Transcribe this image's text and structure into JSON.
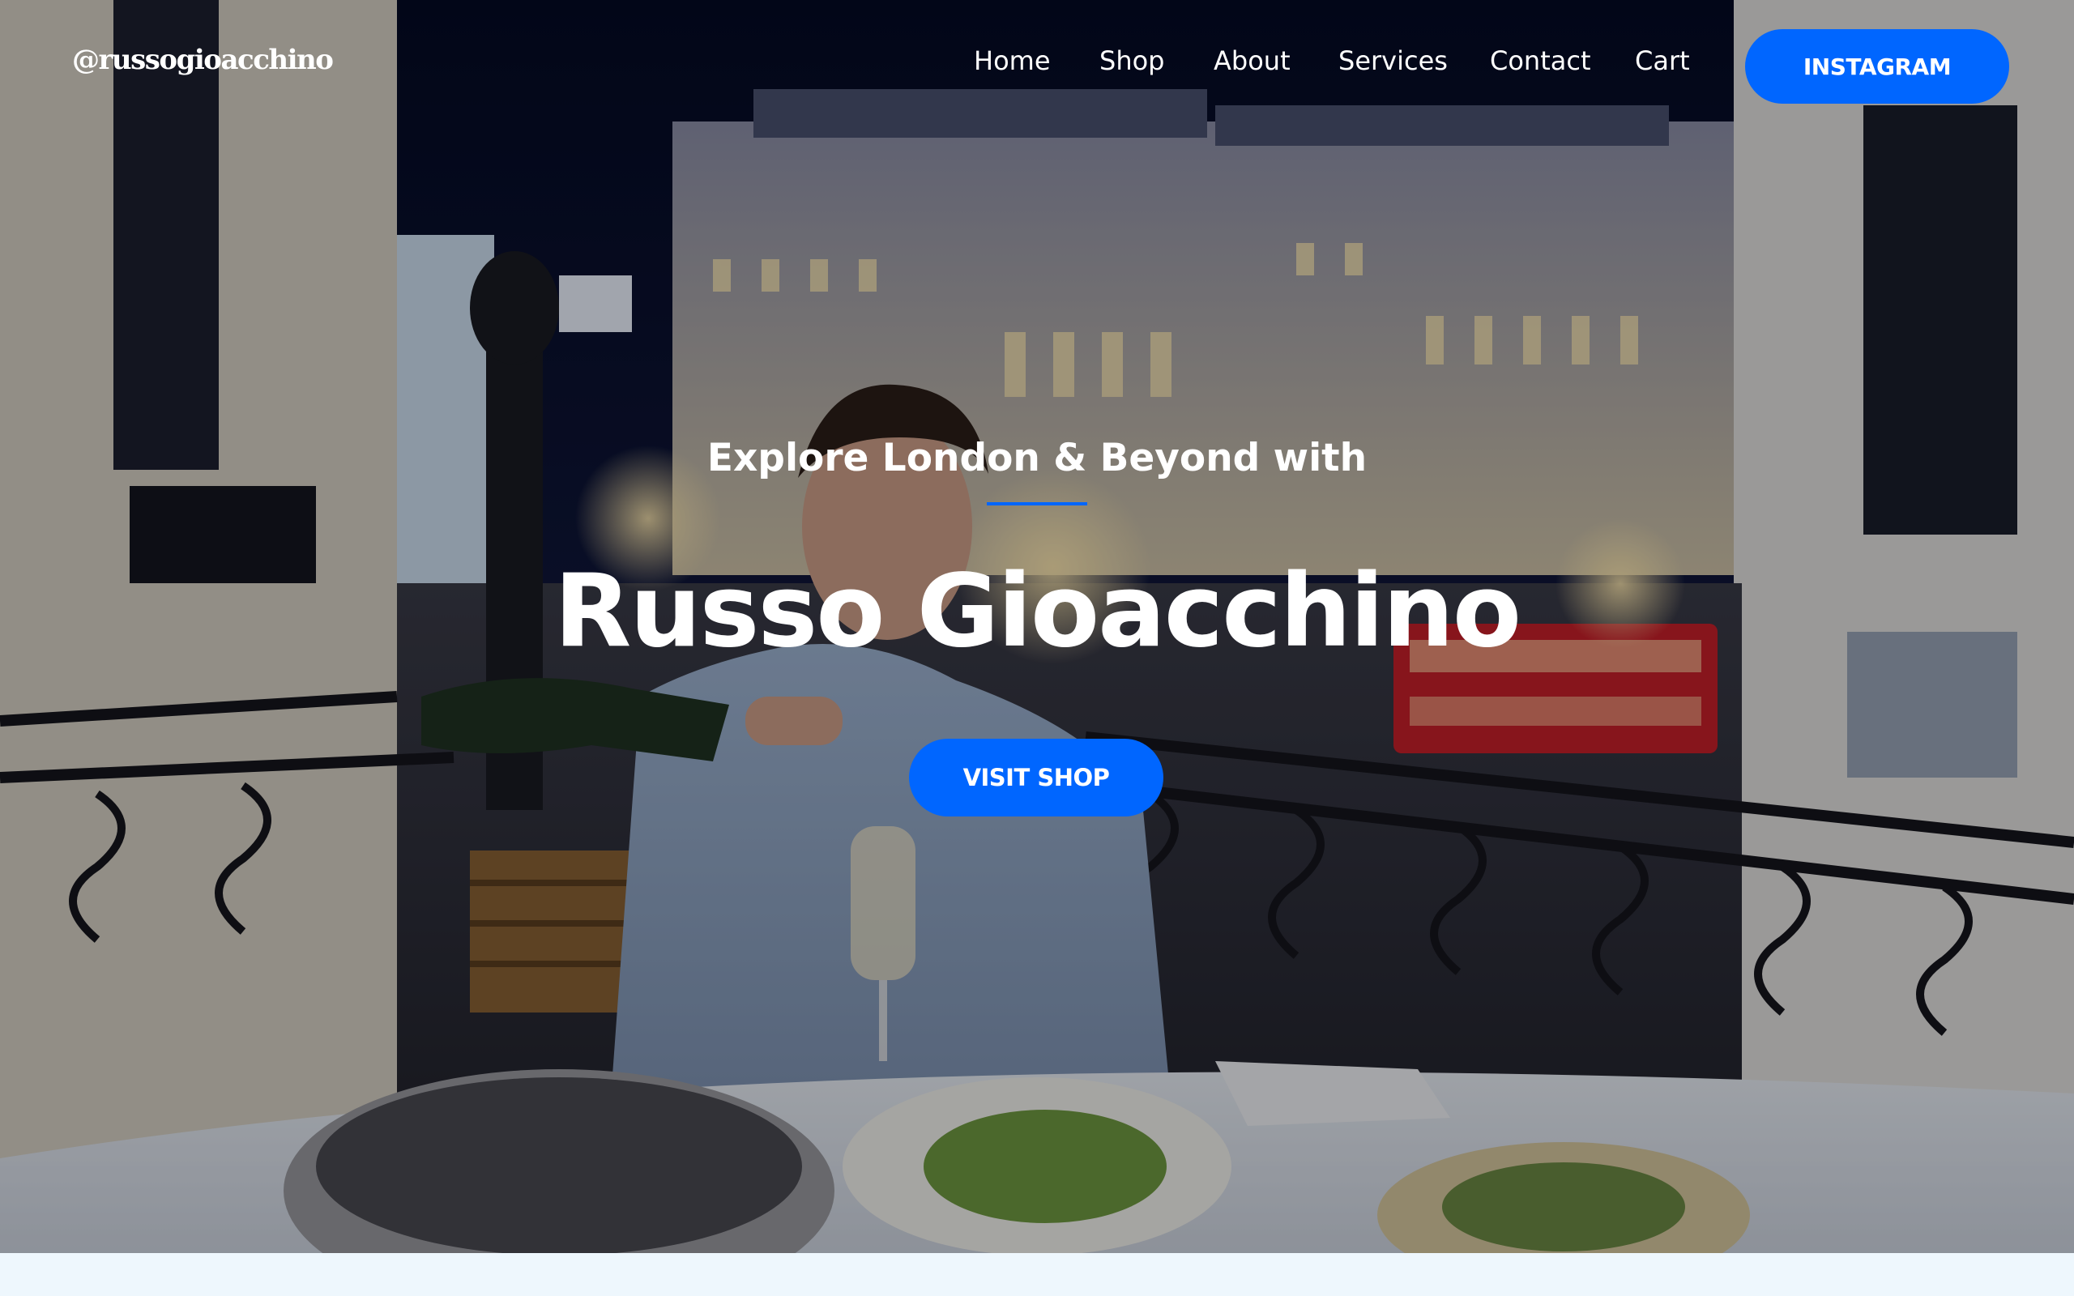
{
  "header": {
    "logo_text": "@russogioacchino",
    "nav": [
      {
        "label": "Home"
      },
      {
        "label": "Shop"
      },
      {
        "label": "About"
      },
      {
        "label": "Services"
      },
      {
        "label": "Contact"
      },
      {
        "label": "Cart"
      }
    ],
    "cta_label": "INSTAGRAM"
  },
  "hero": {
    "kicker": "Explore London & Beyond with",
    "title": "Russo Gioacchino",
    "button_label": "VISIT SHOP",
    "background_image": "man-pouring-champagne-on-balcony-piccadilly-circus-night"
  },
  "colors": {
    "accent": "#0066ff",
    "text": "#ffffff",
    "page_background": "#eef7fd",
    "night_sky": "#0a1334"
  }
}
